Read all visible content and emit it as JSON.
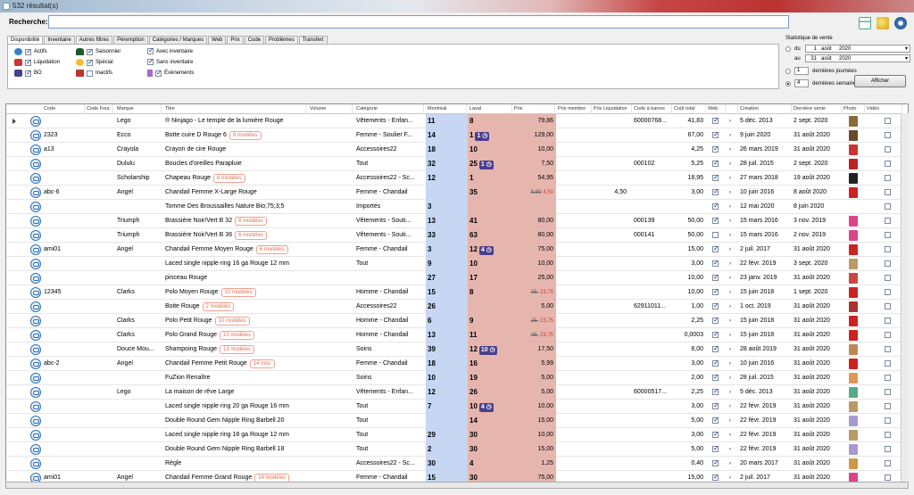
{
  "window": {
    "title": "532 résultat(s)"
  },
  "search": {
    "label": "Recherche:",
    "value": ""
  },
  "tabs": [
    "Disponibilité",
    "Inventaire",
    "Autres filtres",
    "Péremption",
    "Catégories / Marques",
    "Web",
    "Prix",
    "Code",
    "Problèmes",
    "Transfert"
  ],
  "filters": {
    "actifs": "Actifs",
    "liquidation": "Liquidation",
    "bo": "BO",
    "saisonnier": "Saisonnier",
    "special": "Spécial",
    "inactifs": "Inactifs",
    "avec_inventaire": "Avec inventaire",
    "sans_inventaire": "Sans inventaire",
    "evenements": "Événements"
  },
  "stats": {
    "title": "Statistique de vente",
    "du": "du",
    "au": "au",
    "du_day": "1",
    "du_month": "août",
    "du_year": "2020",
    "au_day": "31",
    "au_month": "août",
    "au_year": "2020",
    "days_value": "1",
    "days_label": "dernières journées",
    "weeks_value": "4",
    "weeks_label": "dernières semaines",
    "show_button": "Afficher"
  },
  "columns": [
    "Code",
    "Code Four.",
    "Marque",
    "Titre",
    "Volume",
    "Catégorie",
    "Montréal",
    "Laval",
    "Prix",
    "Prix membre",
    "Prix Liquidation",
    "Code à barres",
    "Coût total",
    "Web",
    "",
    "Création",
    "Dernière vente",
    "Photo",
    "Vidéo"
  ],
  "rows": [
    {
      "code": "",
      "marque": "Lego",
      "titre": "® Ninjago - Le temple de la lumière Rouge",
      "badge": "",
      "cat": "Vêtements - Enfan...",
      "mtl": "11",
      "lav": "8",
      "lavpill": "",
      "prix": "79,86",
      "strike": "",
      "redp": "",
      "liq": "",
      "barcode": "60000768...",
      "cout": "41,83",
      "web": true,
      "creation": "5 déc. 2013",
      "derniere": "2 sept. 2020",
      "photo": "#8a6a3a"
    },
    {
      "code": "2323",
      "marque": "Ecco",
      "titre": "Botte cuire D Rouge 6",
      "badge": "9 modèles",
      "cat": "Femme - Soulier F...",
      "mtl": "14",
      "lav": "1",
      "lavpill": "1",
      "prix": "129,00",
      "strike": "",
      "redp": "",
      "liq": "",
      "barcode": "",
      "cout": "67,00",
      "web": true,
      "creation": "9 juin 2020",
      "derniere": "31 août 2020",
      "photo": "#6b4a2a"
    },
    {
      "code": "a13",
      "marque": "Crayola",
      "titre": "Crayon de cire Rouge",
      "badge": "",
      "cat": "Accessoires22",
      "mtl": "18",
      "lav": "10",
      "lavpill": "",
      "prix": "10,00",
      "strike": "",
      "redp": "",
      "liq": "",
      "barcode": "",
      "cout": "4,25",
      "web": true,
      "creation": "26 mars 2019",
      "derniere": "31 août 2020",
      "photo": "#c33"
    },
    {
      "code": "",
      "marque": "Dululu",
      "titre": "Boucles d'oreilles Parapluie",
      "badge": "",
      "cat": "Tout",
      "mtl": "32",
      "lav": "25",
      "lavpill": "1",
      "prix": "7,50",
      "strike": "",
      "redp": "",
      "liq": "",
      "barcode": "000102",
      "cout": "5,25",
      "web": true,
      "creation": "28 juil. 2015",
      "derniere": "2 sept. 2020",
      "photo": "#b22"
    },
    {
      "code": "",
      "marque": "Scholarship",
      "titre": "Chapeau Rouge",
      "badge": "6 modèles",
      "cat": "Accessoires22 - Sc...",
      "mtl": "12",
      "lav": "1",
      "lavpill": "",
      "prix": "54,95",
      "strike": "",
      "redp": "",
      "liq": "",
      "barcode": "",
      "cout": "18,95",
      "web": true,
      "creation": "27 mars 2018",
      "derniere": "19 août 2020",
      "photo": "#222"
    },
    {
      "code": "abc-6",
      "marque": "Angel",
      "titre": "Chandail Femme X-Large Rouge",
      "badge": "",
      "cat": "Femme - Chandail",
      "mtl": "",
      "lav": "35",
      "lavpill": "",
      "prix": "",
      "strike": "5,99",
      "redp": "4,50",
      "liq": "4,50",
      "barcode": "",
      "cout": "3,00",
      "web": true,
      "creation": "10 juin 2016",
      "derniere": "8 août 2020",
      "photo": "#c22"
    },
    {
      "code": "",
      "marque": "",
      "titre": "Tomme Des Broussailles Nature Bio;75;3;5",
      "badge": "",
      "cat": "Importés",
      "mtl": "3",
      "lav": "",
      "lavpill": "",
      "prix": "",
      "strike": "",
      "redp": "",
      "liq": "",
      "barcode": "",
      "cout": "",
      "web": true,
      "creation": "12 mai 2020",
      "derniere": "8 juin 2020",
      "photo": ""
    },
    {
      "code": "",
      "marque": "Triumph",
      "titre": "Brassière Noir/Vert B 32",
      "badge": "6 modèles",
      "cat": "Vêtements - Souti...",
      "mtl": "13",
      "lav": "41",
      "lavpill": "",
      "prix": "80,00",
      "strike": "",
      "redp": "",
      "liq": "",
      "barcode": "000139",
      "cout": "50,00",
      "web": true,
      "creation": "15 mars 2016",
      "derniere": "3 nov. 2019",
      "photo": "#d48"
    },
    {
      "code": "",
      "marque": "Triumph",
      "titre": "Brassière Noir/Vert B 36",
      "badge": "6 modèles",
      "cat": "Vêtements - Souti...",
      "mtl": "33",
      "lav": "63",
      "lavpill": "",
      "prix": "80,00",
      "strike": "",
      "redp": "",
      "liq": "",
      "barcode": "000141",
      "cout": "50,00",
      "web": false,
      "creation": "15 mars 2016",
      "derniere": "2 nov. 2019",
      "photo": "#d48"
    },
    {
      "code": "ami01",
      "marque": "Angel",
      "titre": "Chandail Femme Moyen Rouge",
      "badge": "6 modèles",
      "cat": "Femme - Chandail",
      "mtl": "3",
      "lav": "12",
      "lavpill": "4",
      "prix": "75,00",
      "strike": "",
      "redp": "",
      "liq": "",
      "barcode": "",
      "cout": "15,00",
      "web": true,
      "creation": "2 juil. 2017",
      "derniere": "31 août 2020",
      "photo": "#c22"
    },
    {
      "code": "",
      "marque": "",
      "titre": "Laced single nipple ring 16 ga Rouge 12 mm",
      "badge": "",
      "cat": "Tout",
      "mtl": "9",
      "lav": "10",
      "lavpill": "",
      "prix": "10,00",
      "strike": "",
      "redp": "",
      "liq": "",
      "barcode": "",
      "cout": "3,00",
      "web": true,
      "creation": "22 févr. 2019",
      "derniere": "3 sept. 2020",
      "photo": "#b96"
    },
    {
      "code": "",
      "marque": "",
      "titre": "pinceau Rouge",
      "badge": "",
      "cat": "",
      "mtl": "27",
      "lav": "17",
      "lavpill": "",
      "prix": "25,00",
      "strike": "",
      "redp": "",
      "liq": "",
      "barcode": "",
      "cout": "10,00",
      "web": true,
      "creation": "23 janv. 2019",
      "derniere": "31 août 2020",
      "photo": "#c44"
    },
    {
      "code": "12345",
      "marque": "Clarks",
      "titre": "Polo Moyen Rouge",
      "badge": "10 modèles",
      "cat": "Homme - Chandail",
      "mtl": "15",
      "lav": "8",
      "lavpill": "",
      "prix": "",
      "strike": "25,",
      "redp": "23,75",
      "liq": "",
      "barcode": "",
      "cout": "10,00",
      "web": true,
      "creation": "15 juin 2018",
      "derniere": "1 sept. 2020",
      "photo": "#c22"
    },
    {
      "code": "",
      "marque": "",
      "titre": "Boite Rouge",
      "badge": "2 modèles",
      "cat": "Accessoires22",
      "mtl": "26",
      "lav": "",
      "lavpill": "",
      "prix": "5,00",
      "strike": "",
      "redp": "",
      "liq": "",
      "barcode": "62911011...",
      "cout": "1,00",
      "web": true,
      "creation": "1 oct. 2019",
      "derniere": "31 août 2020",
      "photo": "#a33"
    },
    {
      "code": "",
      "marque": "Clarks",
      "titre": "Polo Petit Rouge",
      "badge": "10 modèles",
      "cat": "Homme - Chandail",
      "mtl": "6",
      "lav": "9",
      "lavpill": "",
      "prix": "",
      "strike": "25,",
      "redp": "23,75",
      "liq": "",
      "barcode": "",
      "cout": "2,25",
      "web": true,
      "creation": "15 juin 2018",
      "derniere": "31 août 2020",
      "photo": "#c22"
    },
    {
      "code": "",
      "marque": "Clarks",
      "titre": "Polo Grand Rouge",
      "badge": "10 modèles",
      "cat": "Homme - Chandail",
      "mtl": "13",
      "lav": "11",
      "lavpill": "",
      "prix": "",
      "strike": "25,",
      "redp": "23,75",
      "liq": "",
      "barcode": "",
      "cout": "0,0003",
      "web": true,
      "creation": "15 juin 2018",
      "derniere": "31 août 2020",
      "photo": "#c22"
    },
    {
      "code": "",
      "marque": "Douce Mou...",
      "titre": "Shampoing Rouge",
      "badge": "13 modèles",
      "cat": "Soins",
      "mtl": "39",
      "lav": "12",
      "lavpill": "10",
      "prix": "17,50",
      "strike": "",
      "redp": "",
      "liq": "",
      "barcode": "",
      "cout": "8,00",
      "web": true,
      "creation": "28 août 2019",
      "derniere": "31 août 2020",
      "photo": "#b85"
    },
    {
      "code": "abc-2",
      "marque": "Angel",
      "titre": "Chandail Femme Petit Rouge",
      "badge": "14 moc",
      "cat": "Femme - Chandail",
      "mtl": "18",
      "lav": "16",
      "lavpill": "",
      "prix": "5,99",
      "strike": "",
      "redp": "",
      "liq": "",
      "barcode": "",
      "cout": "3,00",
      "web": true,
      "creation": "10 juin 2016",
      "derniere": "31 août 2020",
      "photo": "#c22"
    },
    {
      "code": "",
      "marque": "",
      "titre": "FuZion Renaître",
      "badge": "",
      "cat": "Soins",
      "mtl": "10",
      "lav": "19",
      "lavpill": "",
      "prix": "5,00",
      "strike": "",
      "redp": "",
      "liq": "",
      "barcode": "",
      "cout": "2,00",
      "web": true,
      "creation": "28 juil. 2015",
      "derniere": "31 août 2020",
      "photo": "#d95"
    },
    {
      "code": "",
      "marque": "Lego",
      "titre": "La maison de rêve Large",
      "badge": "",
      "cat": "Vêtements - Enfan...",
      "mtl": "12",
      "lav": "26",
      "lavpill": "",
      "prix": "5,00",
      "strike": "",
      "redp": "",
      "liq": "",
      "barcode": "60000517...",
      "cout": "2,25",
      "web": true,
      "creation": "5 déc. 2013",
      "derniere": "31 août 2020",
      "photo": "#5a8"
    },
    {
      "code": "",
      "marque": "",
      "titre": "Laced single nipple ring 20 ga Rouge 16 mm",
      "badge": "",
      "cat": "Tout",
      "mtl": "7",
      "lav": "10",
      "lavpill": "4",
      "prix": "10,00",
      "strike": "",
      "redp": "",
      "liq": "",
      "barcode": "",
      "cout": "3,00",
      "web": true,
      "creation": "22 févr. 2019",
      "derniere": "31 août 2020",
      "photo": "#b96"
    },
    {
      "code": "",
      "marque": "",
      "titre": "Double Round Gem Nipple Ring Barbell 20",
      "badge": "",
      "cat": "Tout",
      "mtl": "",
      "lav": "14",
      "lavpill": "",
      "prix": "15,00",
      "strike": "",
      "redp": "",
      "liq": "",
      "barcode": "",
      "cout": "5,00",
      "web": true,
      "creation": "22 févr. 2019",
      "derniere": "31 août 2020",
      "photo": "#a9c"
    },
    {
      "code": "",
      "marque": "",
      "titre": "Laced single nipple ring 18 ga Rouge 12 mm",
      "badge": "",
      "cat": "Tout",
      "mtl": "29",
      "lav": "30",
      "lavpill": "",
      "prix": "10,00",
      "strike": "",
      "redp": "",
      "liq": "",
      "barcode": "",
      "cout": "3,00",
      "web": true,
      "creation": "22 févr. 2019",
      "derniere": "31 août 2020",
      "photo": "#b96"
    },
    {
      "code": "",
      "marque": "",
      "titre": "Double Round Gem Nipple Ring Barbell 18",
      "badge": "",
      "cat": "Tout",
      "mtl": "2",
      "lav": "30",
      "lavpill": "",
      "prix": "15,00",
      "strike": "",
      "redp": "",
      "liq": "",
      "barcode": "",
      "cout": "5,00",
      "web": true,
      "creation": "22 févr. 2019",
      "derniere": "31 août 2020",
      "photo": "#a9c"
    },
    {
      "code": "",
      "marque": "",
      "titre": "Règle",
      "badge": "",
      "cat": "Accessoires22 - Sc...",
      "mtl": "30",
      "lav": "4",
      "lavpill": "",
      "prix": "1,25",
      "strike": "",
      "redp": "",
      "liq": "",
      "barcode": "",
      "cout": "0,40",
      "web": true,
      "creation": "20 mars 2017",
      "derniere": "31 août 2020",
      "photo": "#c94"
    },
    {
      "code": "ami01",
      "marque": "Angel",
      "titre": "Chandail Femme Grand Rouge",
      "badge": "14 modèles",
      "cat": "Femme - Chandail",
      "mtl": "15",
      "lav": "30",
      "lavpill": "",
      "prix": "75,00",
      "strike": "",
      "redp": "",
      "liq": "",
      "barcode": "",
      "cout": "15,00",
      "web": true,
      "creation": "2 juil. 2017",
      "derniere": "31 août 2020",
      "photo": "#d48"
    }
  ]
}
